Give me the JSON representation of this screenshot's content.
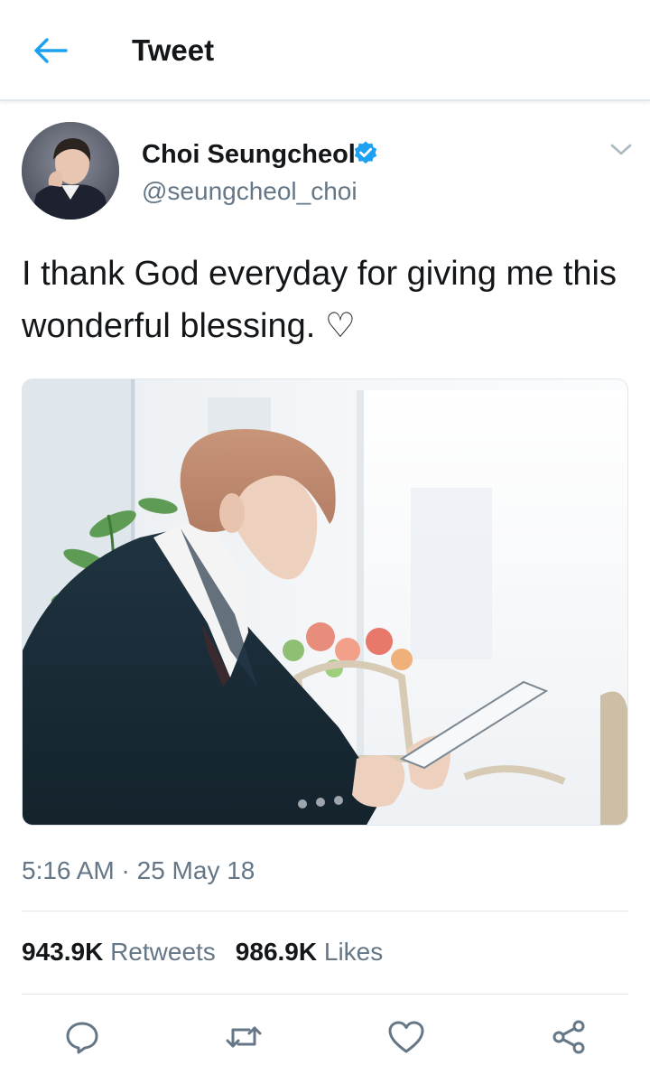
{
  "header": {
    "title": "Tweet",
    "back_icon": "arrow-left-icon",
    "accent_color": "#1da1f2"
  },
  "tweet": {
    "author": {
      "name": "Choi Seungcheol",
      "handle": "@seungcheol_choi",
      "verified": true,
      "verified_icon": "verified-badge-icon"
    },
    "text": "I thank God everyday for giving me this wonderful blessing. ♡",
    "media": {
      "type": "photo"
    },
    "time": "5:16 AM",
    "separator": "·",
    "date": "25 May 18",
    "stats": {
      "retweets_count": "943.9K",
      "retweets_label": "Retweets",
      "likes_count": "986.9K",
      "likes_label": "Likes"
    }
  },
  "actions": [
    {
      "name": "reply",
      "icon": "reply-icon"
    },
    {
      "name": "retweet",
      "icon": "retweet-icon"
    },
    {
      "name": "like",
      "icon": "heart-icon"
    },
    {
      "name": "share",
      "icon": "share-icon"
    }
  ],
  "colors": {
    "primary_text": "#14171a",
    "secondary_text": "#657786",
    "divider": "#e1e8ed",
    "icon_gray": "#657786"
  }
}
